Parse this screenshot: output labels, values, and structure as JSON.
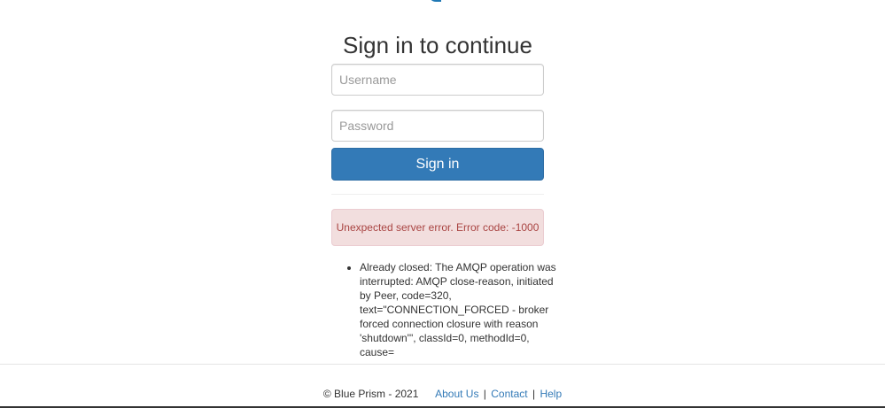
{
  "header": {
    "title": "Sign in to continue"
  },
  "form": {
    "username_placeholder": "Username",
    "password_placeholder": "Password",
    "submit_label": "Sign in"
  },
  "alert": {
    "message": "Unexpected server error. Error code: -1000"
  },
  "error_details": [
    "Already closed: The AMQP operation was interrupted: AMQP close-reason, initiated by Peer, code=320, text=\"CONNECTION_FORCED - broker forced connection closure with reason 'shutdown'\", classId=0, methodId=0, cause="
  ],
  "footer": {
    "copyright": "© Blue Prism - 2021",
    "links": [
      "About Us",
      "Contact",
      "Help"
    ],
    "separator": "|"
  },
  "colors": {
    "primary": "#337ab7",
    "alert_background": "#f2dede",
    "alert_text": "#a94442"
  }
}
